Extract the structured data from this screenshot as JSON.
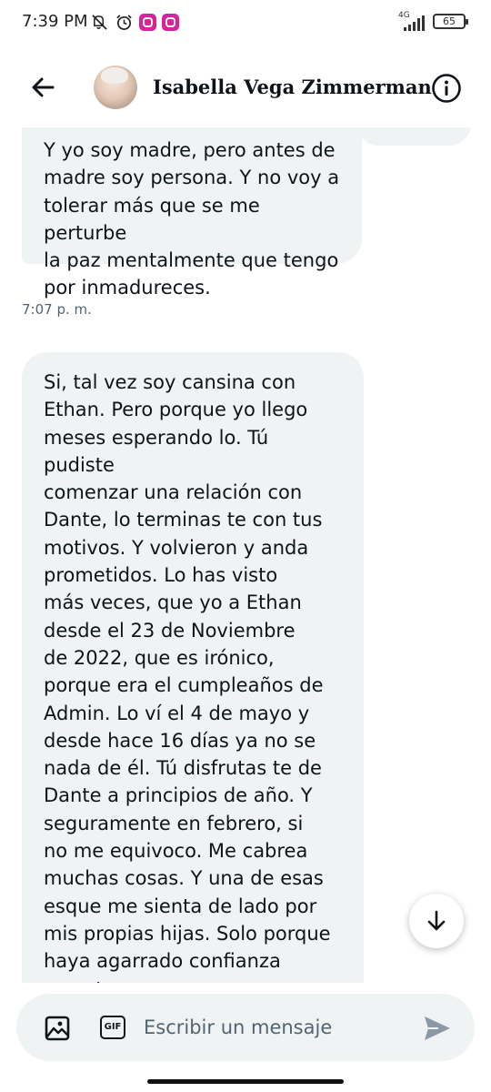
{
  "status_bar": {
    "time": "7:39 PM",
    "network": "4G",
    "battery": "65",
    "icons": [
      "mute-icon",
      "alarm-icon",
      "instagram-icon",
      "instagram-icon",
      "signal-icon",
      "battery-icon"
    ]
  },
  "header": {
    "contact_name": "Isabella Vega Zimmerman",
    "back_icon": "arrow-left-icon",
    "info_icon": "info-icon"
  },
  "messages": [
    {
      "text": "Y yo soy madre, pero antes de\nmadre soy persona. Y no voy a\ntolerar más que se me perturbe\nla paz mentalmente que tengo\npor inmadureces.",
      "timestamp": "7:07 p. m."
    },
    {
      "text": "Si, tal vez soy cansina con\nEthan. Pero porque yo llego\nmeses esperando lo. Tú pudiste\ncomenzar una relación con\nDante, lo terminas te con tus\nmotivos. Y volvieron y anda\nprometidos. Lo has visto\nmás veces, que yo a Ethan\ndesde el 23 de Noviembre\nde 2022, que es irónico,\nporque era el cumpleaños de\nAdmin. Lo ví el 4 de mayo y\ndesde hace 16 días ya no se\nnada de él. Tú disfrutas te de\nDante a principios de año. Y\nseguramente en febrero, si\nno me equivoco. Me cabrea\nmuchas cosas. Y una de esas\nesque me sienta de lado por\nmis propias hijas. Solo porque\nhaya agarrado confianza\ncon otra persona que no sea\nvosotras. Y más cuando llamas"
    }
  ],
  "composer": {
    "placeholder": "Escribir un mensaje",
    "gif_label": "GIF",
    "icons": [
      "image-icon",
      "gif-icon",
      "send-icon"
    ]
  },
  "scroll_button": {
    "icon": "arrow-down-icon"
  },
  "colors": {
    "bubble": "#eff3f4",
    "text": "#0f1419",
    "secondary_text": "#536471",
    "instagram": "#d6249f"
  }
}
